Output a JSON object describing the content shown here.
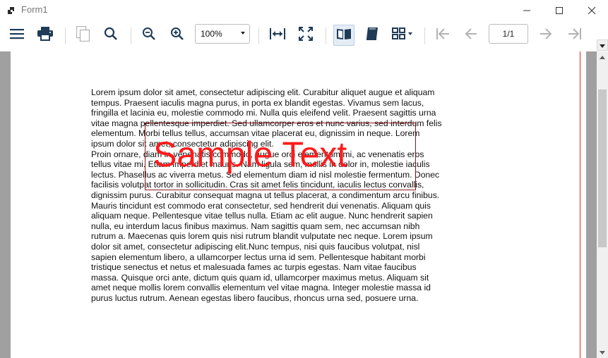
{
  "window": {
    "title": "Form1",
    "icons": [
      "app-icon",
      "minimize-icon",
      "maximize-icon",
      "close-icon"
    ]
  },
  "toolbar": {
    "buttons": [
      {
        "name": "menu-button",
        "icon": "hamburger-menu-icon"
      },
      {
        "name": "print-button",
        "icon": "printer-icon"
      },
      {
        "name": "copy-button",
        "icon": "copy-icon",
        "disabled": true
      },
      {
        "name": "search-button",
        "icon": "search-icon"
      },
      {
        "name": "zoom-out-button",
        "icon": "zoom-out-icon"
      },
      {
        "name": "zoom-in-button",
        "icon": "zoom-in-icon"
      },
      {
        "name": "fit-width-button",
        "icon": "fit-width-icon"
      },
      {
        "name": "fit-page-button",
        "icon": "fit-page-icon"
      },
      {
        "name": "single-page-view-button",
        "icon": "open-book-icon",
        "active": true
      },
      {
        "name": "continuous-view-button",
        "icon": "scroll-book-icon"
      },
      {
        "name": "multiple-pages-button",
        "icon": "grid-icon"
      },
      {
        "name": "first-page-button",
        "icon": "first-page-icon",
        "disabled": true
      },
      {
        "name": "previous-page-button",
        "icon": "previous-arrow-icon",
        "disabled": true
      },
      {
        "name": "next-page-button",
        "icon": "next-arrow-icon",
        "disabled": true
      },
      {
        "name": "last-page-button",
        "icon": "last-page-icon",
        "disabled": true
      }
    ],
    "zoom_value": "100%",
    "page_indicator": "1/1"
  },
  "document": {
    "body_text": "Lorem ipsum dolor sit amet, consectetur adipiscing elit. Curabitur aliquet augue et aliquam\ntempus. Praesent iaculis magna purus, in porta ex blandit egestas. Vivamus sem lacus,\nfringilla et lacinia eu, molestie commodo mi. Nulla quis eleifend velit. Praesent sagittis urna\nvitae magna pellentesque imperdiet. Sed ullamcorper eros et nunc varius, sed interdum felis\nelementum. Morbi tellus tellus, accumsan vitae placerat eu, dignissim in neque. Lorem\nipsum dolor sit amet, consectetur adipiscing elit.\nProin ornare, diam in venenatis commodo, augue orci elementum mi, ac venenatis eros\ntellus vitae mi. Etiam imperdiet mauris. Nam ligula sem, mollis in dolor in, molestie iaculis\nlectus. Phasellus ac viverra metus. Sed elementum diam id nisl molestie fermentum. Donec\nfacilisis volutpat tortor in sollicitudin. Cras sit amet felis tincidunt, iaculis lectus convallis,\ndignissim purus. Curabitur consequat magna ut tellus placerat, a condimentum arcu finibus.\nMauris tincidunt est commodo erat consectetur, sed hendrerit dui venenatis. Aliquam quis\naliquam neque. Pellentesque vitae tellus nulla. Etiam ac elit augue. Nunc hendrerit sapien\nnulla, eu interdum lacus finibus maximus. Nam sagittis quam sem, nec accumsan nibh\nrutrum a. Maecenas quis lorem quis nisi rutrum blandit vulputate nec neque. Lorem ipsum\ndolor sit amet, consectetur adipiscing elit.Nunc tempus, nisi quis faucibus volutpat, nisl\nsapien elementum libero, a ullamcorper lectus urna id sem. Pellentesque habitant morbi\ntristique senectus et netus et malesuada fames ac turpis egestas. Nam vitae faucibus\nmassa. Quisque orci ante, dictum quis quam id, ullamcorper maximus metus. Aliquam sit\namet neque mollis lorem convallis elementum vel vitae magna. Integer molestie massa id\npurus luctus rutrum. Aenean egestas libero faucibus, rhoncus urna sed, posuere urna.",
    "watermark_text": "Sample Text"
  },
  "colors": {
    "watermark": "#ff1a1a",
    "watermark_border": "#8b1a1a",
    "margin_line": "#ee2222",
    "viewer_background": "#a0a0a0"
  }
}
